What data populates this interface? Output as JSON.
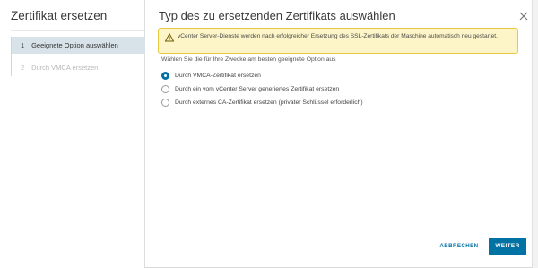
{
  "wizard": {
    "title": "Zertifikat ersetzen",
    "steps": [
      {
        "number": "1",
        "label": "Geeignete Option auswählen",
        "state": "active"
      },
      {
        "number": "2",
        "label": "Durch VMCA ersetzen",
        "state": "disabled"
      }
    ]
  },
  "content": {
    "title": "Typ des zu ersetzenden Zertifikats auswählen",
    "close_icon": "close-icon",
    "alert": {
      "icon": "warning-icon",
      "text": "vCenter Server-Dienste werden nach erfolgreicher Ersetzung des SSL-Zertifikats der Maschine automatisch neu gestartet."
    },
    "subtitle": "Wählen Sie die für Ihre Zwecke am besten geeignete Option aus",
    "options": [
      {
        "label": "Durch VMCA-Zertifikat ersetzen",
        "selected": true
      },
      {
        "label": "Durch ein vom vCenter Server generiertes Zertifikat ersetzen",
        "selected": false
      },
      {
        "label": "Durch externes CA-Zertifikat ersetzen (privater Schlüssel erforderlich)",
        "selected": false
      }
    ]
  },
  "footer": {
    "cancel_label": "ABBRECHEN",
    "next_label": "WEITER"
  },
  "colors": {
    "accent": "#0072a3",
    "alert_bg": "#fdf4c7",
    "alert_border": "#e6c940",
    "active_step_bg": "#d8e3e9"
  }
}
